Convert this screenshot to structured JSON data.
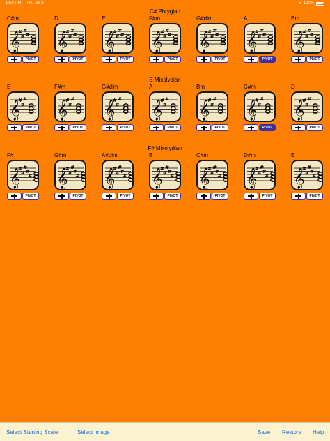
{
  "status_bar": {
    "time": "1:59 PM",
    "date": "Thu Jul 2",
    "battery": "100%"
  },
  "sections": [
    {
      "title": "C# Phrygian",
      "chords": [
        {
          "name": "C#m",
          "accidentals": 4,
          "pivot_active": false
        },
        {
          "name": "D",
          "accidentals": 4,
          "pivot_active": false
        },
        {
          "name": "E",
          "accidentals": 4,
          "pivot_active": false
        },
        {
          "name": "F#m",
          "accidentals": 4,
          "pivot_active": false
        },
        {
          "name": "G#dim",
          "accidentals": 4,
          "pivot_active": false
        },
        {
          "name": "A",
          "accidentals": 4,
          "pivot_active": true
        },
        {
          "name": "Bm",
          "accidentals": 4,
          "pivot_active": false
        }
      ]
    },
    {
      "title": "E Mixolydian",
      "chords": [
        {
          "name": "E",
          "accidentals": 3,
          "pivot_active": false
        },
        {
          "name": "F#m",
          "accidentals": 3,
          "pivot_active": false
        },
        {
          "name": "G#dim",
          "accidentals": 3,
          "pivot_active": false
        },
        {
          "name": "A",
          "accidentals": 3,
          "pivot_active": false
        },
        {
          "name": "Bm",
          "accidentals": 3,
          "pivot_active": false
        },
        {
          "name": "C#m",
          "accidentals": 3,
          "pivot_active": true
        },
        {
          "name": "D",
          "accidentals": 3,
          "pivot_active": false
        }
      ]
    },
    {
      "title": "F# Mixolydian",
      "chords": [
        {
          "name": "F#",
          "accidentals": 5,
          "pivot_active": false
        },
        {
          "name": "G#m",
          "accidentals": 5,
          "pivot_active": false
        },
        {
          "name": "A#dim",
          "accidentals": 5,
          "pivot_active": false
        },
        {
          "name": "B",
          "accidentals": 5,
          "pivot_active": false
        },
        {
          "name": "C#m",
          "accidentals": 5,
          "pivot_active": false
        },
        {
          "name": "D#m",
          "accidentals": 5,
          "pivot_active": false
        },
        {
          "name": "E",
          "accidentals": 5,
          "pivot_active": false
        }
      ]
    }
  ],
  "pivot_label": "PIVOT",
  "toolbar": {
    "select_scale": "Select Starting Scale",
    "select_image": "Select Image",
    "save": "Save",
    "restore": "Restore",
    "help": "Help"
  },
  "colors": {
    "background": "#FF8000",
    "card": "#F5E6C4",
    "button_border": "#3d2fa0",
    "link": "#1a6fd6"
  }
}
